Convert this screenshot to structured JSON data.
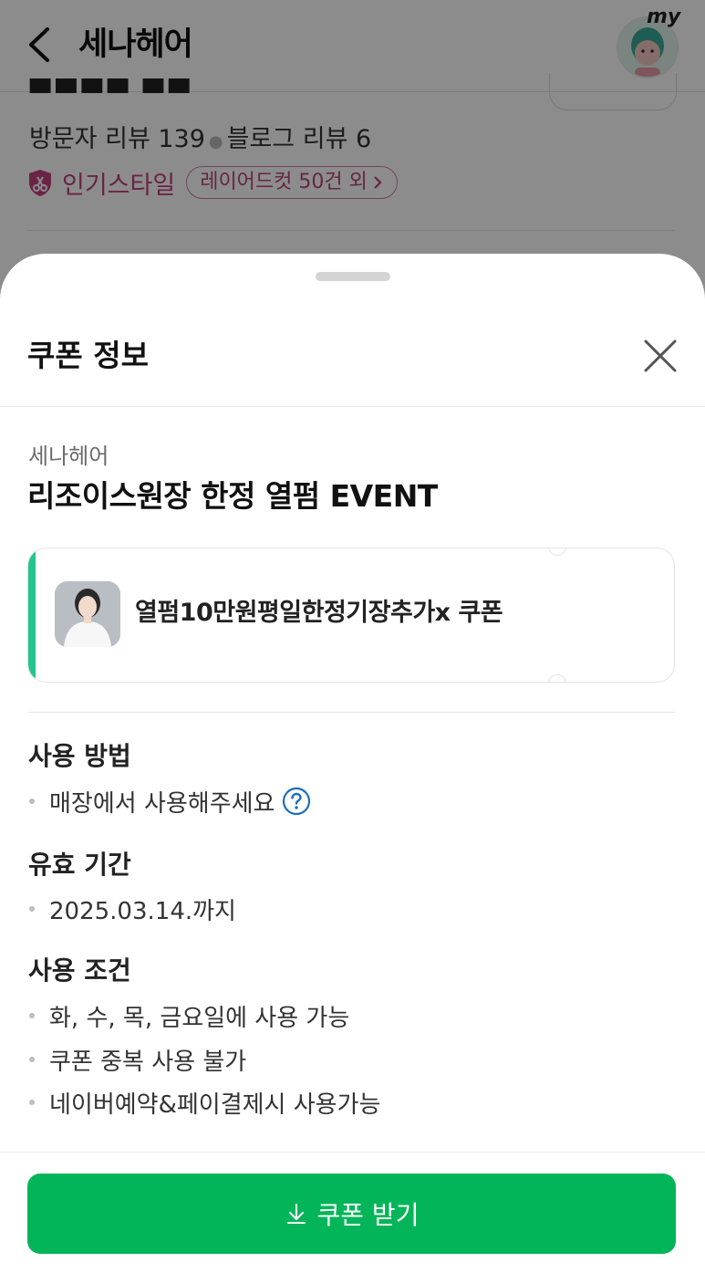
{
  "header": {
    "title": "세나헤어",
    "my_label": "my"
  },
  "background": {
    "visitor_reviews": "방문자 리뷰 139",
    "blog_reviews": "블로그 리뷰 6",
    "popular_style_label": "인기스타일",
    "popular_style_chip": "레이어드컷 50건 외"
  },
  "sheet": {
    "title": "쿠폰 정보",
    "shop_name": "세나헤어",
    "event_title": "리조이스원장 한정 열펌 EVENT",
    "coupon": {
      "name": "열펌10만원평일한정기장추가x 쿠폰",
      "accent_color": "#22c58f"
    },
    "sections": [
      {
        "heading": "사용 방법",
        "items": [
          "매장에서 사용해주세요"
        ]
      },
      {
        "heading": "유효 기간",
        "items": [
          "2025.03.14.까지"
        ]
      },
      {
        "heading": "사용 조건",
        "items": [
          "화, 수, 목, 금요일에 사용 가능",
          "쿠폰 중복 사용 불가",
          "네이버예약&페이결제시 사용가능"
        ]
      }
    ],
    "button_label": "쿠폰 받기",
    "button_color": "#03b559"
  }
}
